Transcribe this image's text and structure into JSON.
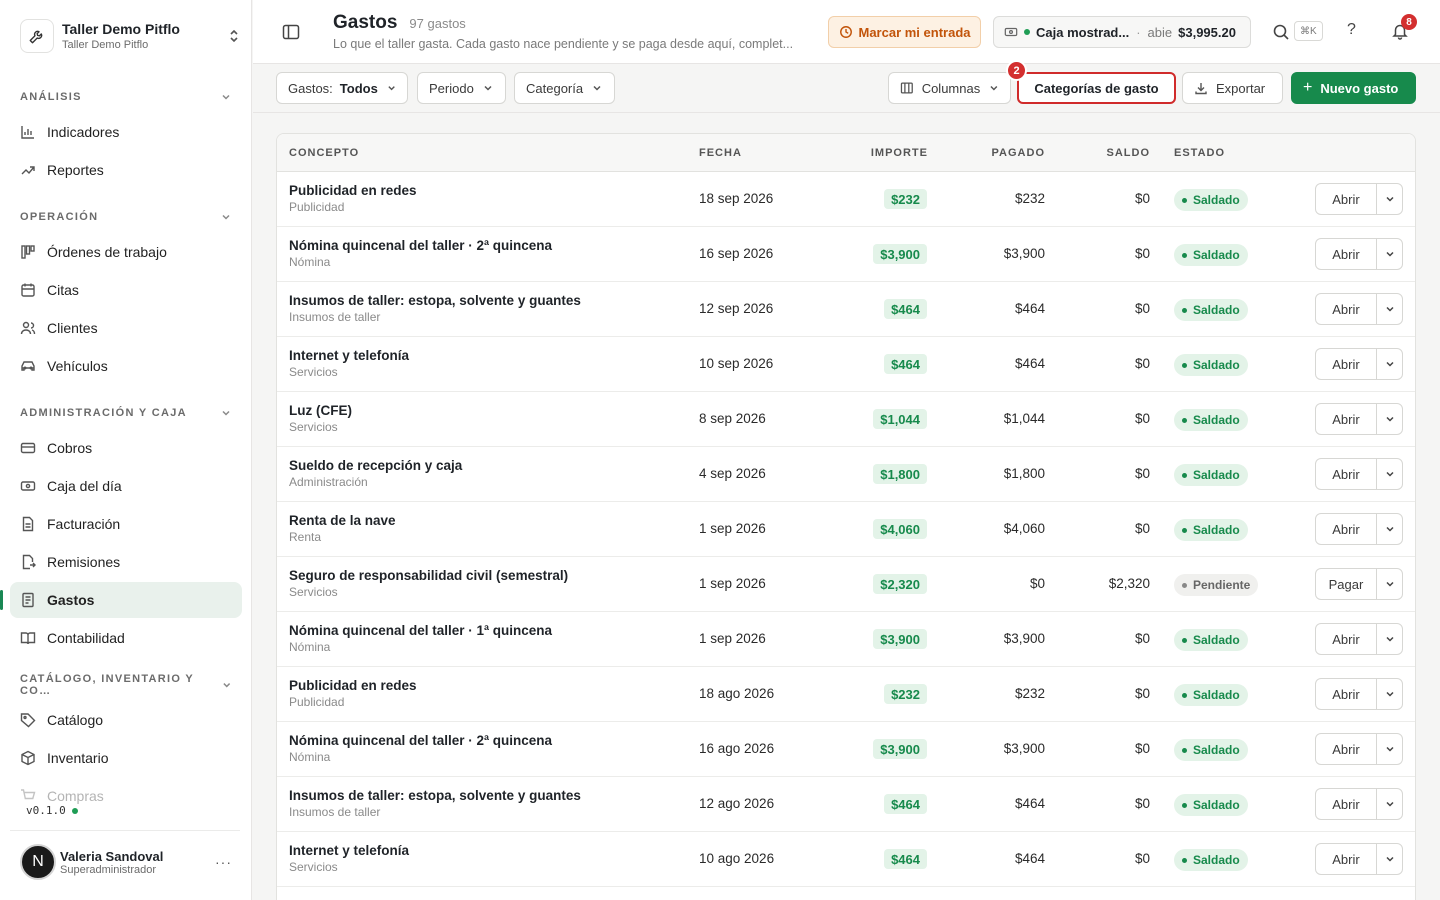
{
  "workspace": {
    "name": "Taller Demo Pitflo",
    "subtitle": "Taller Demo Pitflo"
  },
  "nav": {
    "sections": [
      {
        "title": "ANÁLISIS",
        "items": [
          {
            "label": "Indicadores",
            "icon": "bar-chart-icon"
          },
          {
            "label": "Reportes",
            "icon": "trend-line-icon"
          }
        ]
      },
      {
        "title": "OPERACIÓN",
        "items": [
          {
            "label": "Órdenes de trabajo",
            "icon": "kanban-icon"
          },
          {
            "label": "Citas",
            "icon": "calendar-icon"
          },
          {
            "label": "Clientes",
            "icon": "users-icon"
          },
          {
            "label": "Vehículos",
            "icon": "car-icon"
          }
        ]
      },
      {
        "title": "ADMINISTRACIÓN Y CAJA",
        "items": [
          {
            "label": "Cobros",
            "icon": "credit-card-icon"
          },
          {
            "label": "Caja del día",
            "icon": "cash-register-icon"
          },
          {
            "label": "Facturación",
            "icon": "document-icon"
          },
          {
            "label": "Remisiones",
            "icon": "file-export-icon"
          },
          {
            "label": "Gastos",
            "icon": "receipt-icon",
            "active": true
          },
          {
            "label": "Contabilidad",
            "icon": "book-icon"
          }
        ]
      },
      {
        "title": "CATÁLOGO, INVENTARIO Y CO…",
        "items": [
          {
            "label": "Catálogo",
            "icon": "tag-icon"
          },
          {
            "label": "Inventario",
            "icon": "box-icon"
          },
          {
            "label": "Compras",
            "icon": "cart-icon"
          }
        ]
      }
    ]
  },
  "version": "v0.1.0",
  "user": {
    "initial": "N",
    "name": "Valeria Sandoval",
    "role": "Superadministrador"
  },
  "header": {
    "title": "Gastos",
    "count": "97 gastos",
    "description": "Lo que el taller gasta. Cada gasto nace pendiente y se paga desde aquí, complet...",
    "entry_button": "Marcar mi entrada",
    "cash": {
      "name": "Caja mostrad...",
      "status": "abie",
      "amount": "$3,995.20"
    },
    "shortcut": "⌘K",
    "help": "?",
    "notifications": "8"
  },
  "toolbar": {
    "filter_label": "Gastos:",
    "filter_value": "Todos",
    "period": "Periodo",
    "category": "Categoría",
    "columns": "Columnas",
    "categories_button": "Categorías de gasto",
    "step": "2",
    "export": "Exportar",
    "new": "Nuevo gasto"
  },
  "table": {
    "headers": {
      "concept": "CONCEPTO",
      "date": "FECHA",
      "amount": "IMPORTE",
      "paid": "PAGADO",
      "balance": "SALDO",
      "status": "ESTADO"
    },
    "rows": [
      {
        "concept": "Publicidad en redes",
        "category": "Publicidad",
        "date": "18 sep 2026",
        "amount": "$232",
        "paid": "$232",
        "balance": "$0",
        "status": "Saldado",
        "action": "Abrir"
      },
      {
        "concept": "Nómina quincenal del taller · 2ª quincena",
        "category": "Nómina",
        "date": "16 sep 2026",
        "amount": "$3,900",
        "paid": "$3,900",
        "balance": "$0",
        "status": "Saldado",
        "action": "Abrir"
      },
      {
        "concept": "Insumos de taller: estopa, solvente y guantes",
        "category": "Insumos de taller",
        "date": "12 sep 2026",
        "amount": "$464",
        "paid": "$464",
        "balance": "$0",
        "status": "Saldado",
        "action": "Abrir"
      },
      {
        "concept": "Internet y telefonía",
        "category": "Servicios",
        "date": "10 sep 2026",
        "amount": "$464",
        "paid": "$464",
        "balance": "$0",
        "status": "Saldado",
        "action": "Abrir"
      },
      {
        "concept": "Luz (CFE)",
        "category": "Servicios",
        "date": "8 sep 2026",
        "amount": "$1,044",
        "paid": "$1,044",
        "balance": "$0",
        "status": "Saldado",
        "action": "Abrir"
      },
      {
        "concept": "Sueldo de recepción y caja",
        "category": "Administración",
        "date": "4 sep 2026",
        "amount": "$1,800",
        "paid": "$1,800",
        "balance": "$0",
        "status": "Saldado",
        "action": "Abrir"
      },
      {
        "concept": "Renta de la nave",
        "category": "Renta",
        "date": "1 sep 2026",
        "amount": "$4,060",
        "paid": "$4,060",
        "balance": "$0",
        "status": "Saldado",
        "action": "Abrir"
      },
      {
        "concept": "Seguro de responsabilidad civil (semestral)",
        "category": "Servicios",
        "date": "1 sep 2026",
        "amount": "$2,320",
        "paid": "$0",
        "balance": "$2,320",
        "status": "Pendiente",
        "action": "Pagar"
      },
      {
        "concept": "Nómina quincenal del taller · 1ª quincena",
        "category": "Nómina",
        "date": "1 sep 2026",
        "amount": "$3,900",
        "paid": "$3,900",
        "balance": "$0",
        "status": "Saldado",
        "action": "Abrir"
      },
      {
        "concept": "Publicidad en redes",
        "category": "Publicidad",
        "date": "18 ago 2026",
        "amount": "$232",
        "paid": "$232",
        "balance": "$0",
        "status": "Saldado",
        "action": "Abrir"
      },
      {
        "concept": "Nómina quincenal del taller · 2ª quincena",
        "category": "Nómina",
        "date": "16 ago 2026",
        "amount": "$3,900",
        "paid": "$3,900",
        "balance": "$0",
        "status": "Saldado",
        "action": "Abrir"
      },
      {
        "concept": "Insumos de taller: estopa, solvente y guantes",
        "category": "Insumos de taller",
        "date": "12 ago 2026",
        "amount": "$464",
        "paid": "$464",
        "balance": "$0",
        "status": "Saldado",
        "action": "Abrir"
      },
      {
        "concept": "Internet y telefonía",
        "category": "Servicios",
        "date": "10 ago 2026",
        "amount": "$464",
        "paid": "$464",
        "balance": "$0",
        "status": "Saldado",
        "action": "Abrir"
      }
    ]
  },
  "colors": {
    "accent": "#178a4c",
    "danger": "#d32f2f",
    "warning": "#c2540a"
  }
}
